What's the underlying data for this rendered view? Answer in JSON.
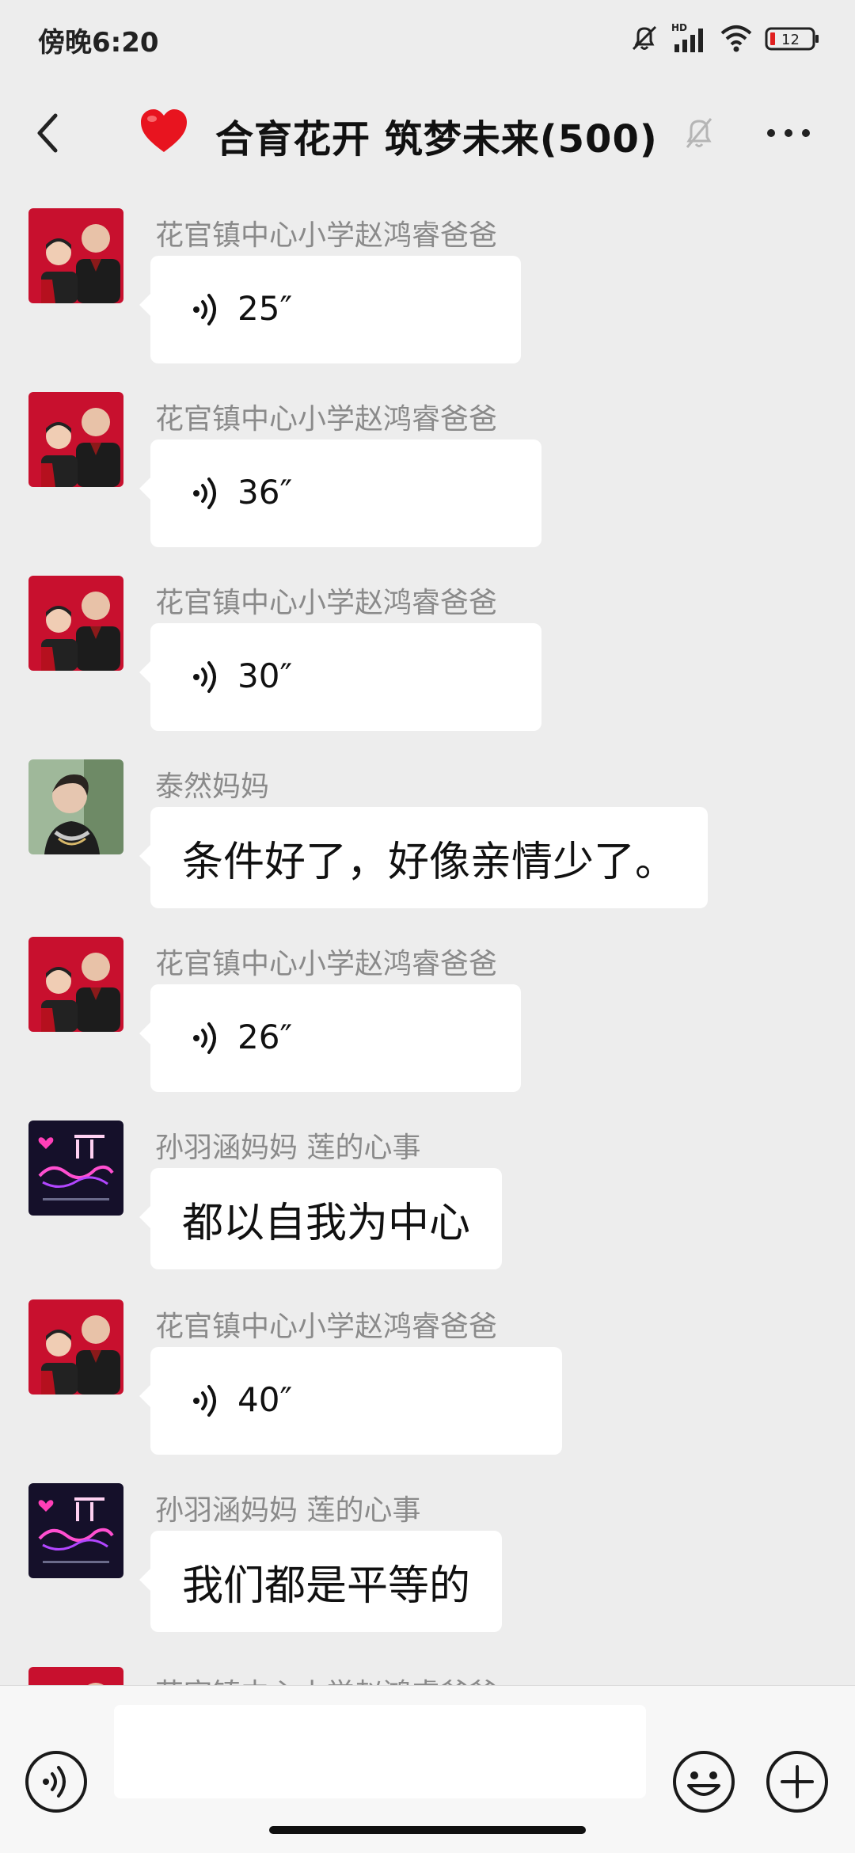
{
  "status_bar": {
    "time": "傍晚6:20",
    "battery_level": "12",
    "network_badge": "HD",
    "icons": [
      "mute-bell-icon",
      "signal-icon",
      "wifi-icon",
      "battery-icon"
    ]
  },
  "header": {
    "title": "合育花开 筑梦未来(500)",
    "emoji": "heart-icon",
    "muted": true
  },
  "messages": [
    {
      "sender": "花官镇中心小学赵鸿睿爸爸",
      "type": "voice",
      "duration": "25″",
      "avatar": "father-son-photo"
    },
    {
      "sender": "花官镇中心小学赵鸿睿爸爸",
      "type": "voice",
      "duration": "36″",
      "avatar": "father-son-photo"
    },
    {
      "sender": "花官镇中心小学赵鸿睿爸爸",
      "type": "voice",
      "duration": "30″",
      "avatar": "father-son-photo"
    },
    {
      "sender": "泰然妈妈",
      "type": "text",
      "text": "条件好了，好像亲情少了。",
      "avatar": "woman-portrait"
    },
    {
      "sender": "花官镇中心小学赵鸿睿爸爸",
      "type": "voice",
      "duration": "26″",
      "avatar": "father-son-photo"
    },
    {
      "sender": "孙羽涵妈妈  莲的心事",
      "type": "text",
      "text": "都以自我为中心",
      "avatar": "neon-sign"
    },
    {
      "sender": "花官镇中心小学赵鸿睿爸爸",
      "type": "voice",
      "duration": "40″",
      "avatar": "father-son-photo"
    },
    {
      "sender": "孙羽涵妈妈  莲的心事",
      "type": "text",
      "text": "我们都是平等的",
      "avatar": "neon-sign"
    },
    {
      "sender": "花官镇中心小学赵鸿睿爸爸",
      "type": "partial",
      "avatar": "father-son-photo"
    }
  ],
  "input_bar": {
    "text_value": "",
    "left_icon": "voice-input-icon",
    "right_icons": [
      "emoji-icon",
      "plus-icon"
    ]
  },
  "colors": {
    "background": "#ededed",
    "bubble": "#ffffff",
    "sender_name": "#8a8a8a",
    "avatar_red": "#c8102e",
    "heart": "#e8141f"
  }
}
